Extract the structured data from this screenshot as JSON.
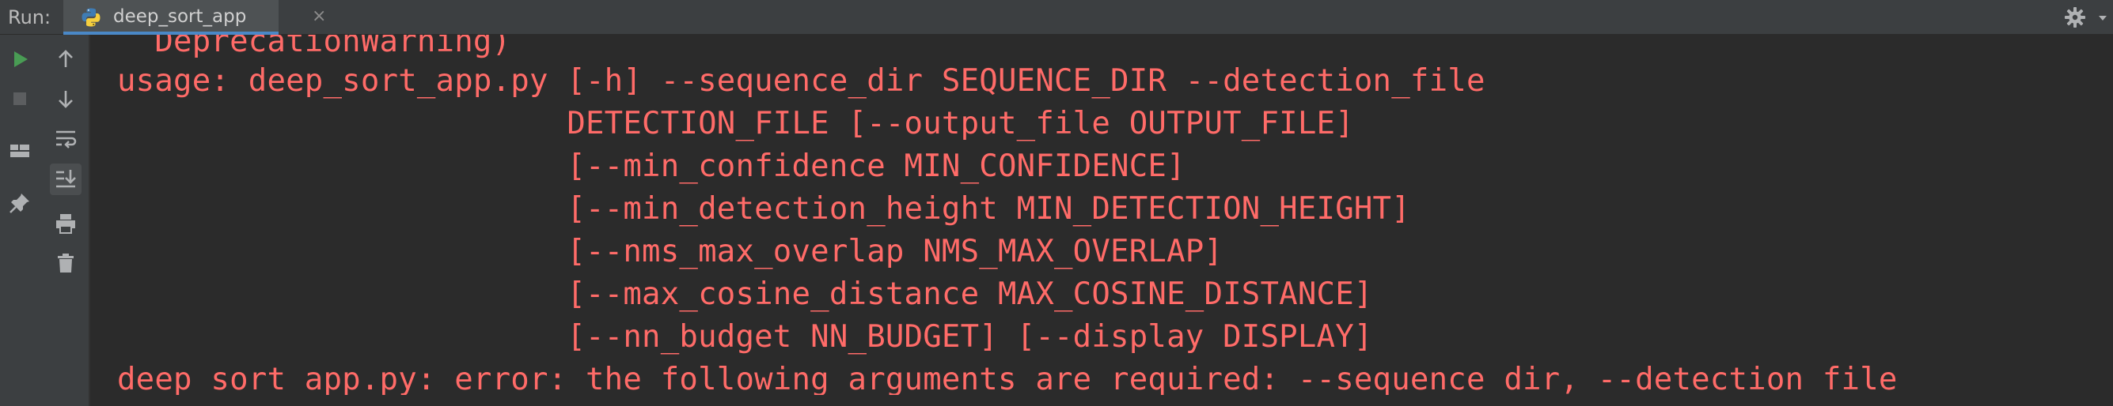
{
  "tabbar": {
    "run_label": "Run:",
    "active_tab": {
      "label": "deep_sort_app",
      "icon": "python-file-icon",
      "close_glyph": "×"
    },
    "right_icons": [
      "gear-icon",
      "more-options-icon"
    ]
  },
  "toolbar": {
    "buttons": [
      {
        "name": "run-icon",
        "state": "enabled",
        "color": "#499c54"
      },
      {
        "name": "stop-icon",
        "state": "disabled"
      },
      {
        "name": "up-arrow-icon",
        "state": "enabled"
      },
      {
        "name": "down-arrow-icon",
        "state": "enabled"
      },
      {
        "name": "soft-wrap-icon",
        "state": "enabled"
      },
      {
        "name": "scroll-to-end-icon",
        "state": "active"
      },
      {
        "name": "layout-icon",
        "state": "enabled"
      },
      {
        "name": "print-icon",
        "state": "enabled"
      },
      {
        "name": "pin-icon",
        "state": "enabled"
      },
      {
        "name": "trash-icon",
        "state": "enabled"
      }
    ]
  },
  "console": {
    "text_color": "#ff6b68",
    "lines": [
      "  DeprecationWarning)",
      "usage: deep_sort_app.py [-h] --sequence_dir SEQUENCE_DIR --detection_file",
      "                        DETECTION_FILE [--output_file OUTPUT_FILE]",
      "                        [--min_confidence MIN_CONFIDENCE]",
      "                        [--min_detection_height MIN_DETECTION_HEIGHT]",
      "                        [--nms_max_overlap NMS_MAX_OVERLAP]",
      "                        [--max_cosine_distance MAX_COSINE_DISTANCE]",
      "                        [--nn_budget NN_BUDGET] [--display DISPLAY]",
      "deep_sort_app.py: error: the following arguments are required: --sequence_dir, --detection_file"
    ]
  },
  "colors": {
    "background": "#2b2b2b",
    "panel": "#3c3f41",
    "error_text": "#ff6b68",
    "accent": "#4a88c7"
  }
}
